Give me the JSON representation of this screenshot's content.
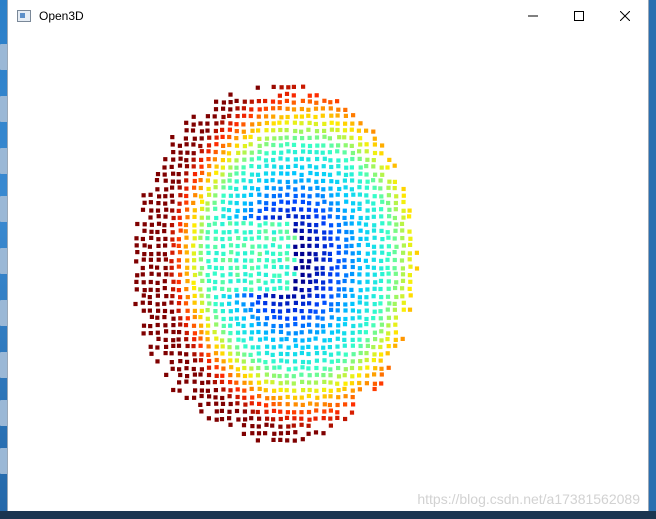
{
  "window": {
    "title": "Open3D",
    "controls": {
      "minimize": "minimize",
      "maximize": "maximize",
      "close": "close"
    }
  },
  "viewport": {
    "content": "point-cloud",
    "colormap": [
      "#7f0000",
      "#ff2a00",
      "#ffee00",
      "#36ffc8",
      "#00c8ff",
      "#0046ff",
      "#00008f"
    ],
    "background": "#ffffff"
  },
  "watermark": {
    "text": "https://blog.csdn.net/a17381562089"
  },
  "icons": [
    "app-window-icon",
    "minimize-icon",
    "maximize-icon",
    "close-icon"
  ]
}
